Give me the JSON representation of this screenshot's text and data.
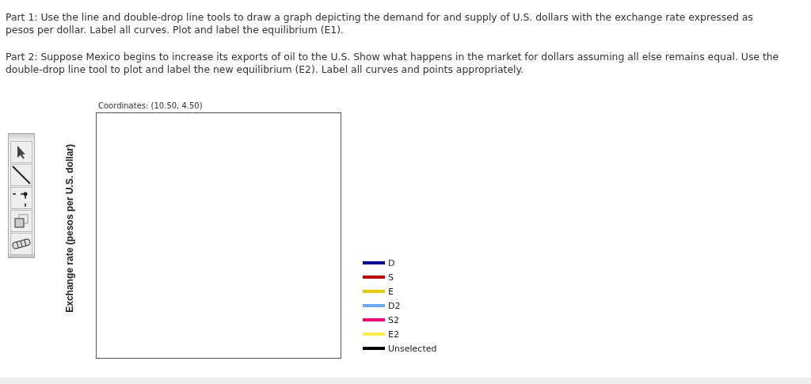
{
  "instructions": [
    "Part 1: Use the line and double-drop line tools to draw a graph depicting the demand for and supply of U.S. dollars with the exchange rate expressed as pesos per dollar. Label all curves. Plot and label the equilibrium (E1).",
    "Part 2: Suppose Mexico begins to increase its exports of oil to the U.S. Show what happens in the market for dollars assuming all else remains equal. Use the double-drop line tool to plot and label the new equilibrium (E2). Label all curves and points appropriately."
  ],
  "toolbar": [
    {
      "kind": "pointer"
    },
    {
      "kind": "line"
    },
    {
      "kind": "double-drop"
    },
    {
      "kind": "copy"
    },
    {
      "kind": "eraser"
    }
  ],
  "graph": {
    "ylabel": "Exchange rate (pesos per U.S. dollar)",
    "coordinates": "Coordinates: (10.50, 4.50)"
  },
  "legend": [
    {
      "label": "D",
      "color": "#000099"
    },
    {
      "label": "S",
      "color": "#cc0000"
    },
    {
      "label": "E",
      "color": "#e6cc00"
    },
    {
      "label": "D2",
      "color": "#66aaff"
    },
    {
      "label": "S2",
      "color": "#ff0077"
    },
    {
      "label": "E2",
      "color": "#ffee44"
    },
    {
      "label": "Unselected",
      "color": "#000000"
    }
  ]
}
